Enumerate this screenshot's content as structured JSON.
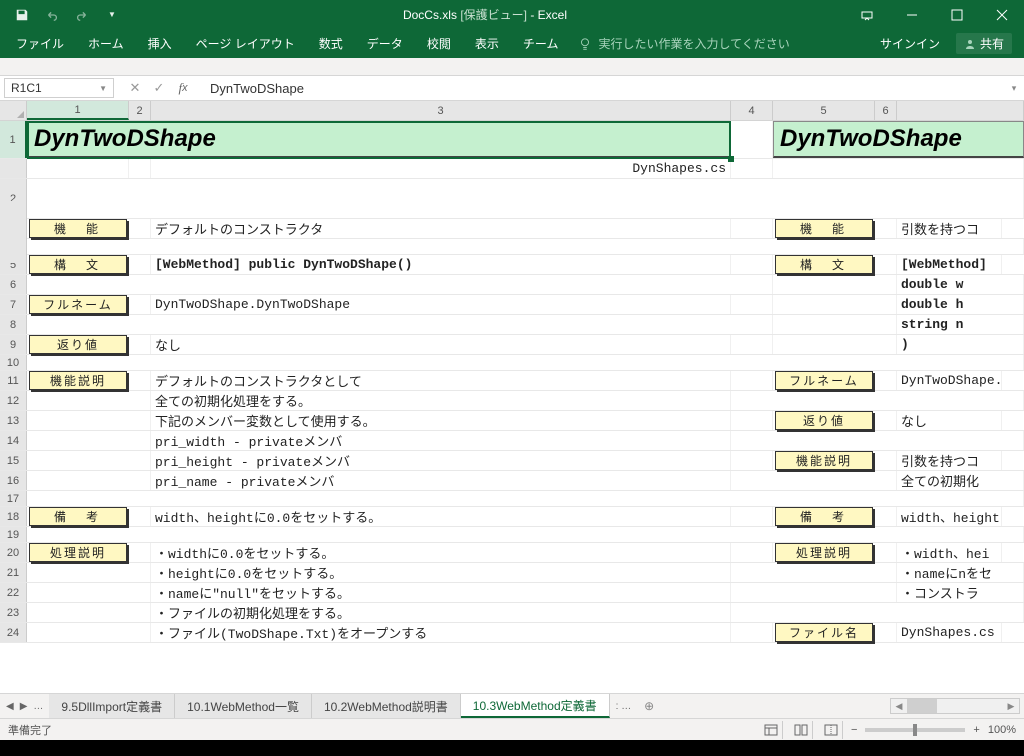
{
  "titlebar": {
    "filename": "DocCs.xls",
    "protected": "[保護ビュー]",
    "app": "Excel"
  },
  "ribbon": {
    "tabs": [
      "ファイル",
      "ホーム",
      "挿入",
      "ページ レイアウト",
      "数式",
      "データ",
      "校閲",
      "表示",
      "チーム"
    ],
    "tellme_placeholder": "実行したい作業を入力してください",
    "signin": "サインイン",
    "share": "共有"
  },
  "formula": {
    "namebox": "R1C1",
    "content": "DynTwoDShape"
  },
  "columns": {
    "c1": "1",
    "c2": "2",
    "c3": "3",
    "c4": "4",
    "c5": "5",
    "c6": "6"
  },
  "cells": {
    "title1": "DynTwoDShape",
    "title2": "DynTwoDShape",
    "subtitle": "DynShapes.cs",
    "r3_label": "機　能",
    "r3_val": "デフォルトのコンストラクタ",
    "r3b_label": "機　能",
    "r3b_val": "引数を持つコ",
    "r5_label": "構　文",
    "r5_val": "[WebMethod] public DynTwoDShape()",
    "r5b_label": "構　文",
    "r5b_val": "[WebMethod]",
    "r6_val": " double w",
    "r7_label": "フルネーム",
    "r7_val": "DynTwoDShape.DynTwoDShape",
    "r7b_val": " double h",
    "r8_val": " string n",
    "r9_label": "返り値",
    "r9_val": "なし",
    "r9b_val": ")",
    "r11_label": "機能説明",
    "r11_val": "デフォルトのコンストラクタとして",
    "r11b_label": "フルネーム",
    "r11b_val": "DynTwoDShape.",
    "r12_val": "全ての初期化処理をする。",
    "r13_val": "下記のメンバー変数として使用する。",
    "r13b_label": "返り値",
    "r13b_val": "なし",
    "r14_val": " pri_width - privateメンバ",
    "r15_val": " pri_height - privateメンバ",
    "r15b_label": "機能説明",
    "r15b_val": "引数を持つコ",
    "r16_val": " pri_name - privateメンバ",
    "r16b_val": "全ての初期化",
    "r18_label": "備　考",
    "r18_val": "width、heightに0.0をセットする。",
    "r18b_label": "備　考",
    "r18b_val": "width、height",
    "r20_label": "処理説明",
    "r20_val": "・widthに0.0をセットする。",
    "r20b_label": "処理説明",
    "r20b_val": "・width、hei",
    "r21_val": "・heightに0.0をセットする。",
    "r21b_val": "・nameにnをセ",
    "r22_val": "・nameに\"null\"をセットする。",
    "r22b_val": "・コンストラ",
    "r23_val": "・ファイルの初期化処理をする。",
    "r24_val": "・ファイル(TwoDShape.Txt)をオープンする",
    "r24b_label": "ファイル名",
    "r24b_val": "DynShapes.cs"
  },
  "sheets": {
    "tabs": [
      "9.5DllImport定義書",
      "10.1WebMethod一覧",
      "10.2WebMethod説明書",
      "10.3WebMethod定義書"
    ],
    "active_index": 3,
    "more": "…"
  },
  "statusbar": {
    "ready": "準備完了",
    "zoom": "100%"
  }
}
